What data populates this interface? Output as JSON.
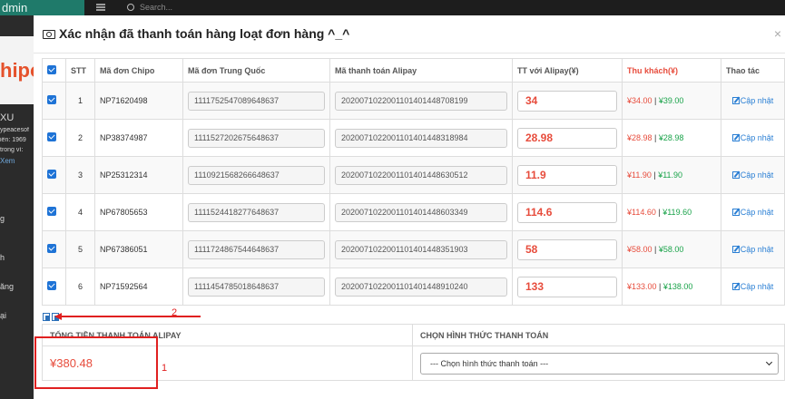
{
  "background": {
    "brand_fragment": "dmin",
    "search_placeholder": "Search...",
    "logo_fragment": "hipo",
    "side_texts": [
      "XU",
      "ypeacesof",
      "iền: 1969",
      "trong ví: ",
      "Xem",
      "g",
      "h",
      "ăng",
      "ại"
    ]
  },
  "modal": {
    "title": "Xác nhận đã thanh toán hàng loạt đơn hàng ^_^",
    "close": "×"
  },
  "table": {
    "headers": {
      "stt": "STT",
      "chipo": "Mã đơn Chipo",
      "china": "Mã đơn Trung Quốc",
      "alipay": "Mã thanh toán Alipay",
      "tt": "TT với Alipay(¥)",
      "thu": "Thu khách(¥)",
      "action": "Thao tác"
    },
    "rows": [
      {
        "stt": "1",
        "chipo": "NP71620498",
        "china": "1111752547089648637",
        "alipay": "2020071022001101401448708199",
        "amount": "34",
        "thu_rmb": "¥34.00",
        "thu_sep": " | ",
        "thu_total": "¥39.00",
        "action": "Cập nhật"
      },
      {
        "stt": "2",
        "chipo": "NP38374987",
        "china": "1111527202675648637",
        "alipay": "2020071022001101401448318984",
        "amount": "28.98",
        "thu_rmb": "¥28.98",
        "thu_sep": " | ",
        "thu_total": "¥28.98",
        "action": "Cập nhật"
      },
      {
        "stt": "3",
        "chipo": "NP25312314",
        "china": "1110921568266648637",
        "alipay": "2020071022001101401448630512",
        "amount": "11.9",
        "thu_rmb": "¥11.90",
        "thu_sep": " | ",
        "thu_total": "¥11.90",
        "action": "Cập nhật"
      },
      {
        "stt": "4",
        "chipo": "NP67805653",
        "china": "1111524418277648637",
        "alipay": "2020071022001101401448603349",
        "amount": "114.6",
        "thu_rmb": "¥114.60",
        "thu_sep": " | ",
        "thu_total": "¥119.60",
        "action": "Cập nhật"
      },
      {
        "stt": "5",
        "chipo": "NP67386051",
        "china": "1111724867544648637",
        "alipay": "2020071022001101401448351903",
        "amount": "58",
        "thu_rmb": "¥58.00",
        "thu_sep": " | ",
        "thu_total": "¥58.00",
        "action": "Cập nhật"
      },
      {
        "stt": "6",
        "chipo": "NP71592564",
        "china": "1111454785018648637",
        "alipay": "2020071022001101401448910240",
        "amount": "133",
        "thu_rmb": "¥133.00",
        "thu_sep": " | ",
        "thu_total": "¥138.00",
        "action": "Cập nhật"
      }
    ]
  },
  "payment": {
    "total_label": "TỔNG TIỀN THANH TOÁN ALIPAY",
    "total_value": "¥380.48",
    "method_label": "CHỌN HÌNH THỨC THANH TOÁN",
    "method_selected": "--- Chọn hình thức thanh toán ---"
  },
  "annotations": {
    "label_1": "1",
    "label_2": "2"
  },
  "colors": {
    "accent_red": "#e74c3c",
    "green": "#1aa34a",
    "link_blue": "#2a7fd4",
    "checkbox_blue": "#1e73d6",
    "annotation_red": "#e02020"
  }
}
